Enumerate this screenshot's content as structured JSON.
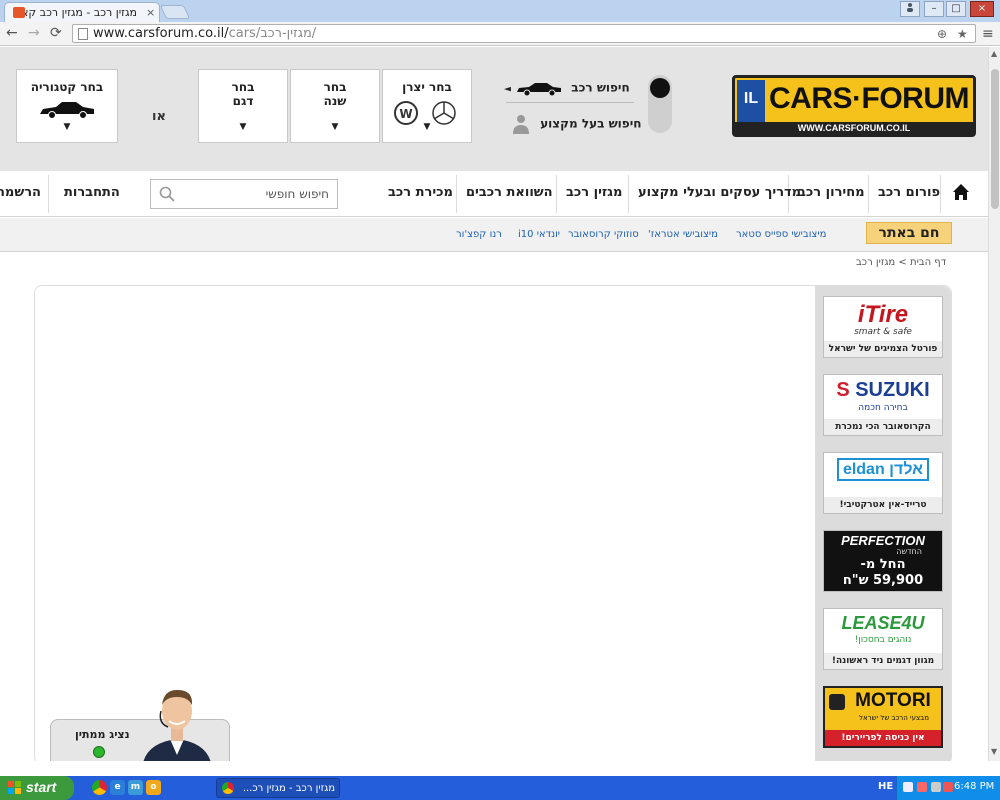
{
  "browser": {
    "tab_title": "מגזין רכב - מגזין רכב קארי",
    "tab_close": "×",
    "url_host": "www.carsforum.co.il/",
    "url_path": "cars/מגזין-רכב/",
    "win_min": "–",
    "win_max": "□",
    "win_close": "×",
    "user_icon": "person-icon"
  },
  "header": {
    "logo_il": "IL",
    "logo_text": "CARS·FORUM",
    "logo_url": "WWW.CARSFORUM.CO.IL",
    "search_car": "חיפוש רכב",
    "search_pro": "חיפוש בעל מקצוע",
    "select_maker": "בחר יצרן",
    "select_year": "בחר\nשנה",
    "select_model": "בחר\nדגם",
    "or": "או",
    "select_category": "בחר קטגוריה"
  },
  "nav": {
    "items": [
      "פורום רכב",
      "מחירון רכב",
      "מדריך עסקים ובעלי מקצוע",
      "מגזין רכב",
      "השוואת רכבים",
      "מכירת רכב",
      "התחברות",
      "הרשמה"
    ],
    "search_placeholder": "חיפוש חופשי"
  },
  "hot": {
    "label": "חם באתר",
    "links": [
      "מיצובישי ספייס סטאר",
      "מיצובישי אטראז'",
      "סוזוקי קרוסאובר",
      "יונדאי i10",
      "רנו קפצ'ור"
    ]
  },
  "breadcrumb": {
    "home": "דף הבית",
    "sep": ">",
    "current": "מגזין רכב"
  },
  "ads": [
    {
      "logo": "iTire",
      "sub": "smart & safe",
      "caption": "פורטל הצמיגים של ישראל"
    },
    {
      "logo": "SUZUKI",
      "sub": "בחירה חכמה",
      "caption": "הקרוסאובר הכי נמכרת"
    },
    {
      "logo": "eldan אלדן",
      "sub": "",
      "caption": "טרייד-אין אטרקטיבי!"
    },
    {
      "logo": "PERFECTION",
      "sub": "החדשה",
      "price1": "החל מ-",
      "price2": "59,900 ש\"ח",
      "caption": ""
    },
    {
      "logo": "LEASE4U",
      "sub": "נוהגים בחסכון!",
      "caption": "מגוון דגמים ניד ראשונה!"
    },
    {
      "logo": "MOTORI",
      "sub": "מבצעי הרכב של ישראל",
      "caption": "אין כניסה לפריירים!"
    }
  ],
  "chat": {
    "title": "נציג ממתין"
  },
  "taskbar": {
    "start": "start",
    "task_title": "מגזין רכב - מגזין רכ...",
    "lang": "HE",
    "time": "6:48 PM"
  },
  "colors": {
    "accent": "#f4c21a",
    "link": "#1d5fb4",
    "hot_bg": "#f6d37a",
    "taskbar": "#245edb"
  }
}
